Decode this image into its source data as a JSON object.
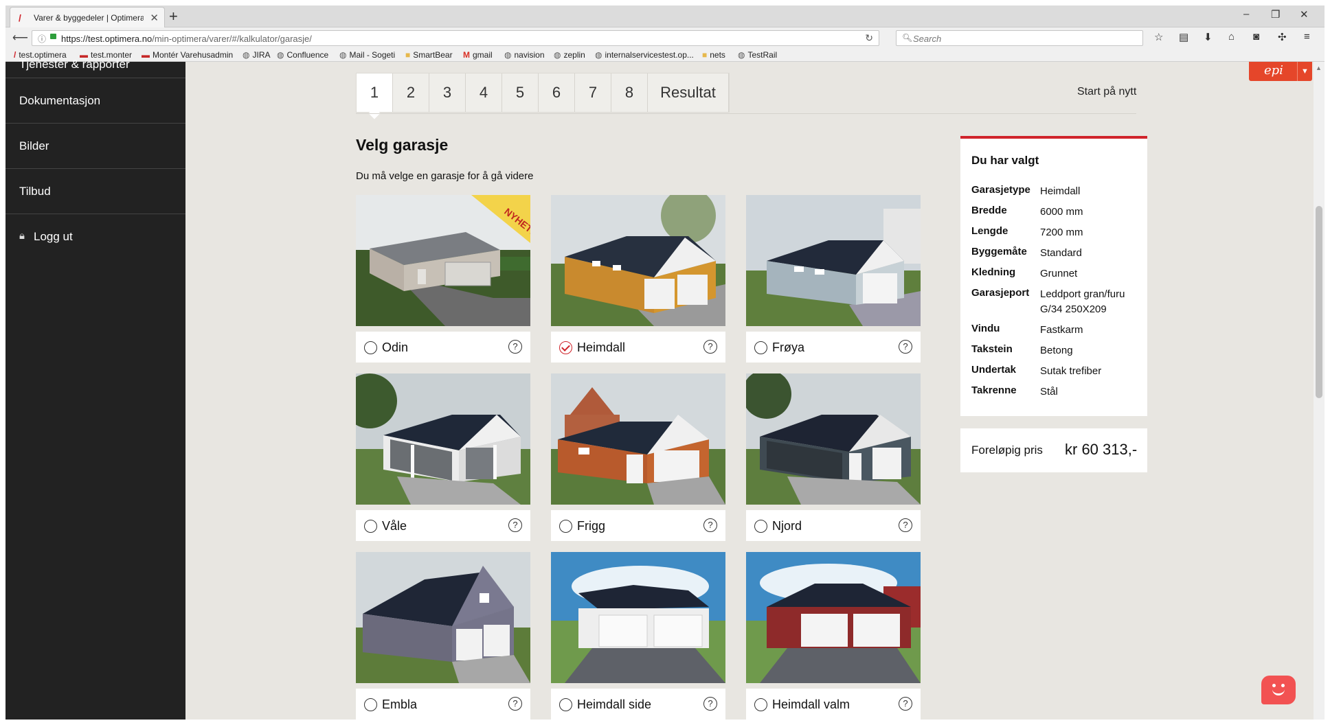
{
  "browser": {
    "tab_title": "Varer & byggedeler | Optimera",
    "tab_icon": "optimera-logo-icon",
    "url_host": "https://test.optimera.no",
    "url_path": "/min-optimera/varer/#/kalkulator/garasje/",
    "search_placeholder": "Search"
  },
  "bookmarks": [
    {
      "label": "test.optimera",
      "icon": "optimera-logo-icon"
    },
    {
      "label": "test.monter",
      "icon": "monter-logo-icon"
    },
    {
      "label": "Montér Varehusadmin",
      "icon": "monter-logo-icon"
    },
    {
      "label": "JIRA",
      "icon": "globe-icon"
    },
    {
      "label": "Confluence",
      "icon": "globe-icon"
    },
    {
      "label": "Mail - Sogeti",
      "icon": "globe-icon"
    },
    {
      "label": "SmartBear",
      "icon": "folder-icon"
    },
    {
      "label": "gmail",
      "icon": "gmail-icon"
    },
    {
      "label": "navision",
      "icon": "globe-icon"
    },
    {
      "label": "zeplin",
      "icon": "globe-icon"
    },
    {
      "label": "internalservicestest.op...",
      "icon": "globe-icon"
    },
    {
      "label": "nets",
      "icon": "folder-icon"
    },
    {
      "label": "TestRail",
      "icon": "globe-icon"
    }
  ],
  "sidebar": {
    "partial_item": "Tjenester & rapporter",
    "items": [
      "Dokumentasjon",
      "Bilder",
      "Tilbud"
    ],
    "logout": "Logg ut"
  },
  "steps": [
    "1",
    "2",
    "3",
    "4",
    "5",
    "6",
    "7",
    "8",
    "Resultat"
  ],
  "active_step": "1",
  "restart": "Start på nytt",
  "page_title": "Velg garasje",
  "instruction": "Du må velge en garasje for å gå videre",
  "garages": [
    {
      "name": "Odin",
      "selected": false,
      "badge": "NYHET!"
    },
    {
      "name": "Heimdall",
      "selected": true
    },
    {
      "name": "Frøya",
      "selected": false
    },
    {
      "name": "Våle",
      "selected": false
    },
    {
      "name": "Frigg",
      "selected": false
    },
    {
      "name": "Njord",
      "selected": false
    },
    {
      "name": "Embla",
      "selected": false
    },
    {
      "name": "Heimdall side",
      "selected": false
    },
    {
      "name": "Heimdall valm",
      "selected": false
    }
  ],
  "help_glyph": "?",
  "summary": {
    "title": "Du har valgt",
    "rows": [
      {
        "key": "Garasjetype",
        "value": "Heimdall"
      },
      {
        "key": "Bredde",
        "value": "6000 mm"
      },
      {
        "key": "Lengde",
        "value": "7200 mm"
      },
      {
        "key": "Byggemåte",
        "value": "Standard"
      },
      {
        "key": "Kledning",
        "value": "Grunnet"
      },
      {
        "key": "Garasjeport",
        "value": "Leddport gran/furu G/34 250X209"
      },
      {
        "key": "Vindu",
        "value": "Fastkarm"
      },
      {
        "key": "Takstein",
        "value": "Betong"
      },
      {
        "key": "Undertak",
        "value": "Sutak trefiber"
      },
      {
        "key": "Takrenne",
        "value": "Stål"
      }
    ]
  },
  "price": {
    "label": "Foreløpig pris",
    "value": "kr 60 313,-"
  },
  "colors": {
    "accent": "#d0242b",
    "sidebar": "#222222",
    "page_bg": "#e8e6e1",
    "episerver": "#e5462a"
  }
}
